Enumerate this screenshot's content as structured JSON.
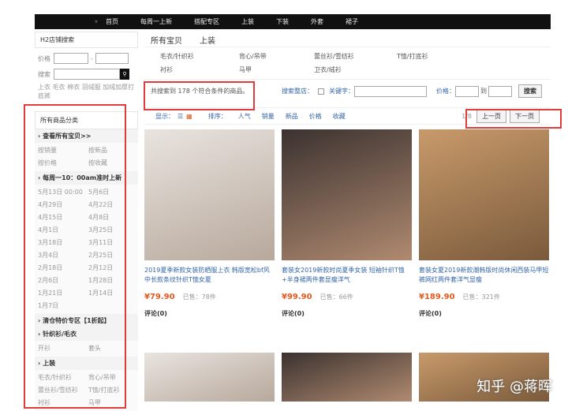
{
  "nav": {
    "items": [
      "首页",
      "每周一上新",
      "搭配专区",
      "上装",
      "下装",
      "外套",
      "裙子"
    ]
  },
  "sidebar": {
    "search_title": "H2店铺搜索",
    "price_label": "价格",
    "search_label": "搜索",
    "tags": "上衣 毛衣 棉衣 羽绒服 加绒加厚打底裤",
    "cat_title": "所有商品分类",
    "groups": [
      {
        "title": "查看所有宝贝>>",
        "items": [
          "按销量",
          "按新品",
          "按价格",
          "按收藏"
        ]
      },
      {
        "title": "每周一10：00am准时上新",
        "items": [
          "5月13日 00:00",
          "5月6日",
          "4月29日",
          "4月22日",
          "4月15日",
          "4月8日",
          "4月1日",
          "3月25日",
          "3月18日",
          "3月11日",
          "3月4日",
          "2月25日",
          "2月18日",
          "2月12日",
          "2月6日",
          "1月28日",
          "1月21日",
          "1月14日",
          "1月7日"
        ]
      },
      {
        "title": "清仓特价专区【1折起】",
        "items": []
      },
      {
        "title": "针织衫/毛衣",
        "items": [
          "开衫",
          "套头"
        ]
      },
      {
        "title": "上装",
        "items": [
          "毛衣/针织衫",
          "背心/吊带",
          "蕾丝衫/雪纺衫",
          "T恤/打底衫",
          "衬衫",
          "马甲"
        ]
      }
    ]
  },
  "main": {
    "crumbs": [
      "所有宝贝",
      "上装"
    ],
    "subcats": [
      "毛衣/针织衫",
      "背心/吊带",
      "蕾丝衫/雪纺衫",
      "T恤/打底衫",
      "衬衫",
      "马甲",
      "卫衣/绒衫"
    ],
    "result_text": "共搜索到 178 个符合条件的商品。",
    "search_store": "搜索整店：",
    "keyword": "关键字：",
    "price": "价格：",
    "to": "到",
    "search_btn": "搜索",
    "display": "显示：",
    "sort_label": "排序：",
    "sorts": [
      "人气",
      "销量",
      "新品",
      "价格",
      "收藏"
    ],
    "page": "1/8",
    "prev": "上一页",
    "next": "下一页",
    "products": [
      {
        "title": "2019夏季新款女装防晒服上衣 韩版宽松bf风中长款条纹针织T恤女夏",
        "price": "¥79.90",
        "sold": "已售：78件",
        "comments": "评论(0)"
      },
      {
        "title": "套装女2019新款时尚夏季女装 短袖针织T恤+半身裙两件套显瘦洋气",
        "price": "¥99.90",
        "sold": "已售：66件",
        "comments": "评论(0)"
      },
      {
        "title": "套装女夏2019新款潮韩版时尚休闲西装马甲短裤网红两件套洋气显瘦",
        "price": "¥189.90",
        "sold": "已售：321件",
        "comments": "评论(0)"
      }
    ]
  },
  "watermark": "知乎 @蒋晖"
}
